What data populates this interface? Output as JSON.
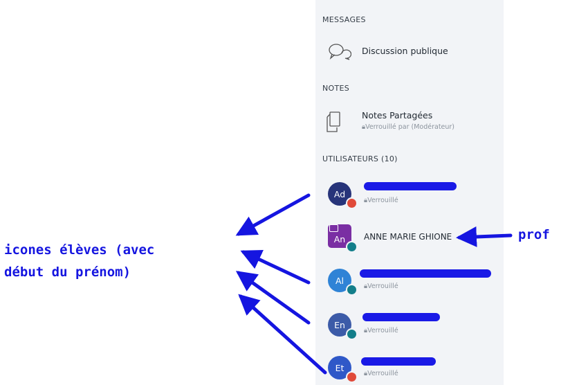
{
  "messages": {
    "title": "MESSAGES",
    "public_chat": {
      "label": "Discussion publique",
      "icon": "chat-bubbles-icon"
    }
  },
  "notes": {
    "title": "NOTES",
    "shared": {
      "label": "Notes Partagées",
      "status": "Verrouillé par (Modérateur)",
      "icon": "document-copy-icon"
    }
  },
  "users": {
    "title": "UTILISATEURS (10)",
    "list": [
      {
        "initials": "Ad",
        "status": "Verrouillé",
        "color": "#27347a",
        "badge": "#e04a3a"
      },
      {
        "initials": "An",
        "name": "ANNE MARIE GHIONE",
        "color": "#7a2ea3",
        "badge": "#137e8a"
      },
      {
        "initials": "Al",
        "status": "Verrouillé",
        "color": "#2f83d6",
        "badge": "#137e8a"
      },
      {
        "initials": "En",
        "status": "Verrouillé",
        "color": "#3c5ba8",
        "badge": "#137e8a"
      },
      {
        "initials": "Et",
        "status": "Verrouillé",
        "color": "#2f58c8",
        "badge": "#e04a3a"
      }
    ]
  },
  "annotations": {
    "students_line1": "icones élèves (avec",
    "students_line2": "début du prénom)",
    "teacher": "prof",
    "color": "#1515e0"
  }
}
